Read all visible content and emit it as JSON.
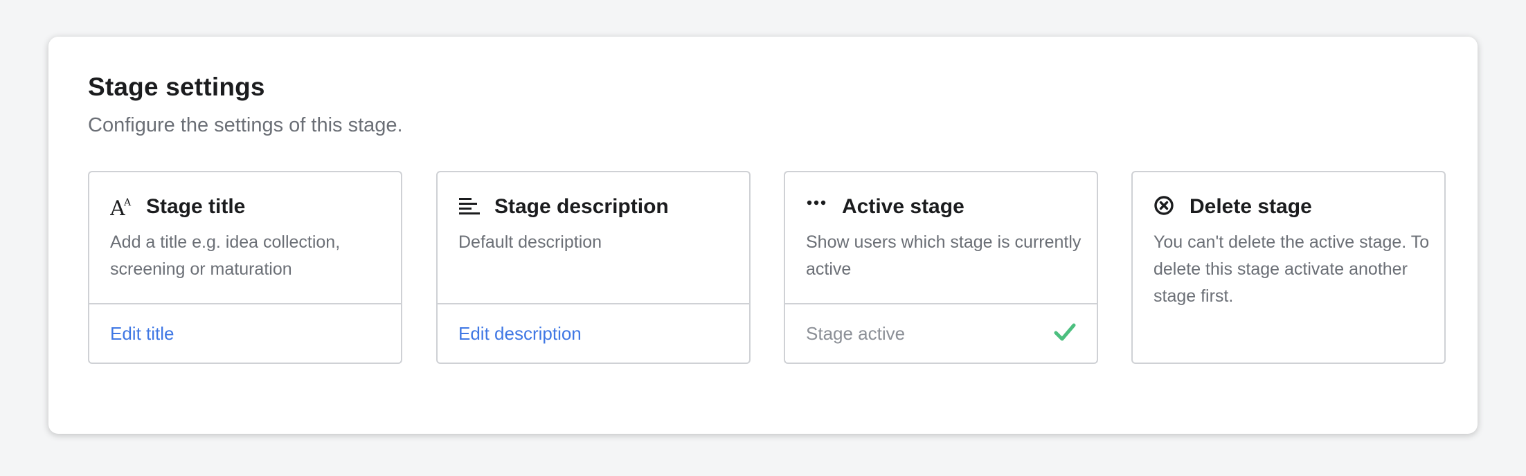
{
  "header": {
    "title": "Stage settings",
    "subtitle": "Configure the settings of this stage."
  },
  "cards": [
    {
      "icon": "text-size-icon",
      "title": "Stage title",
      "description": "Add a title e.g. idea collection, screening or maturation",
      "action_label": "Edit title"
    },
    {
      "icon": "text-align-left-icon",
      "title": "Stage description",
      "description": "Default description",
      "action_label": "Edit description"
    },
    {
      "icon": "ellipsis-icon",
      "title": "Active stage",
      "description": "Show users which stage is currently active",
      "status_label": "Stage active",
      "status_icon": "check-icon"
    },
    {
      "icon": "close-circle-icon",
      "title": "Delete stage",
      "description": "You can't delete the active stage. To delete this stage activate another stage first."
    }
  ],
  "colors": {
    "link": "#3f77e4",
    "success": "#4cbf7f",
    "border": "#cfd1d5",
    "text": "#1b1c1e",
    "muted": "#6b6f76"
  }
}
